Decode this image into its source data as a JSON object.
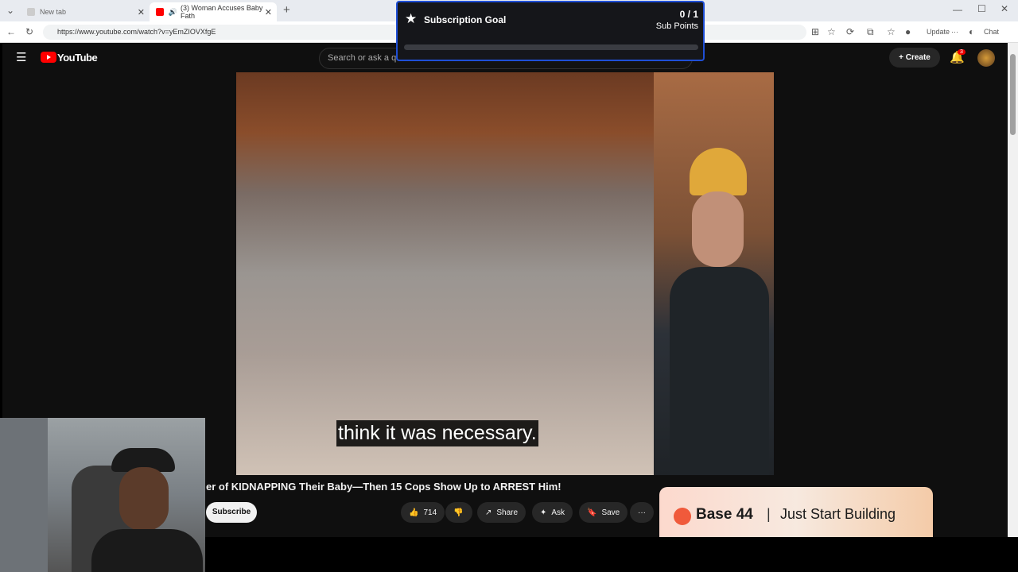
{
  "browser": {
    "tabs": [
      {
        "label": "New tab"
      },
      {
        "label": "(3) Woman Accuses Baby Fath"
      }
    ],
    "url": "https://www.youtube.com/watch?v=yEmZIOVXfgE",
    "update_label": "Update",
    "chat_label": "Chat"
  },
  "youtube": {
    "logo": "YouTube",
    "search_placeholder": "Search or ask a qu",
    "create_label": "Create",
    "notif_count": "3",
    "caption": "think it was necessary.",
    "video_title": "er of KIDNAPPING Their Baby—Then 15 Cops Show Up to ARREST Him!",
    "subscribe": "Subscribe",
    "likes": "714",
    "share": "Share",
    "ask": "Ask",
    "save": "Save",
    "ad": {
      "brand": "Base 44",
      "separator": "|",
      "tagline": "Just Start Building"
    }
  },
  "overlay": {
    "title": "Subscription Goal",
    "count": "0 / 1",
    "label": "Sub Points",
    "progress": 0.0
  }
}
